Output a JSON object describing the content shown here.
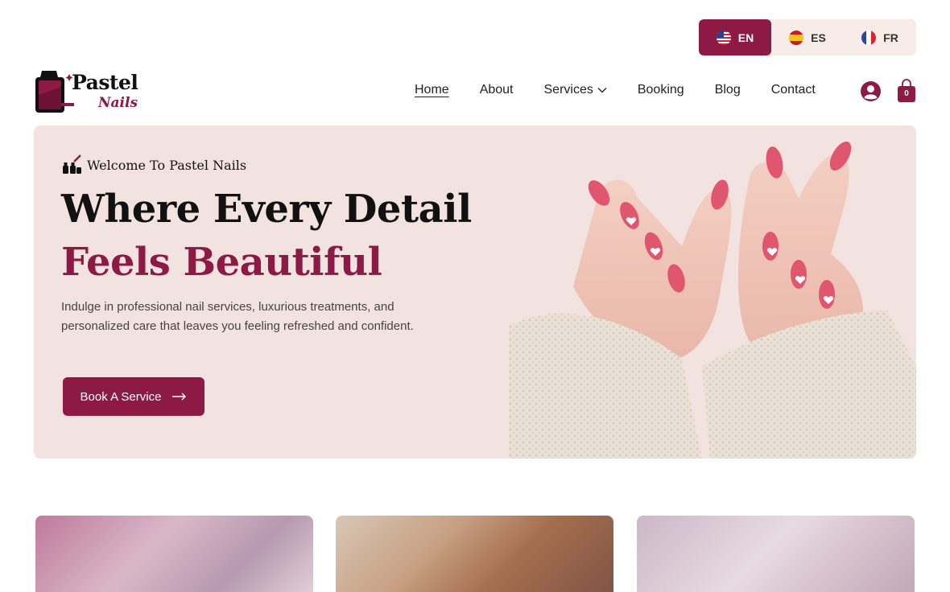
{
  "languages": [
    {
      "code": "EN",
      "flag": "us-flag-icon",
      "active": true
    },
    {
      "code": "ES",
      "flag": "spain-flag-icon",
      "active": false
    },
    {
      "code": "FR",
      "flag": "france-flag-icon",
      "active": false
    }
  ],
  "brand": {
    "name_main": "Pastel",
    "name_sub": "Nails"
  },
  "nav": {
    "home": "Home",
    "about": "About",
    "services": "Services",
    "booking": "Booking",
    "blog": "Blog",
    "contact": "Contact",
    "cart_count": "0"
  },
  "hero": {
    "eyebrow": "Welcome To Pastel Nails",
    "title_line1": "Where Every Detail",
    "title_line2": "Feels Beautiful",
    "description": "Indulge in professional nail services, luxurious treatments, and personalized care that leaves you feeling refreshed and confident.",
    "cta_label": "Book A Service"
  },
  "colors": {
    "accent": "#8c1a44",
    "hero_bg": "#f3e3e0",
    "lang_bg": "#f7ece8"
  }
}
